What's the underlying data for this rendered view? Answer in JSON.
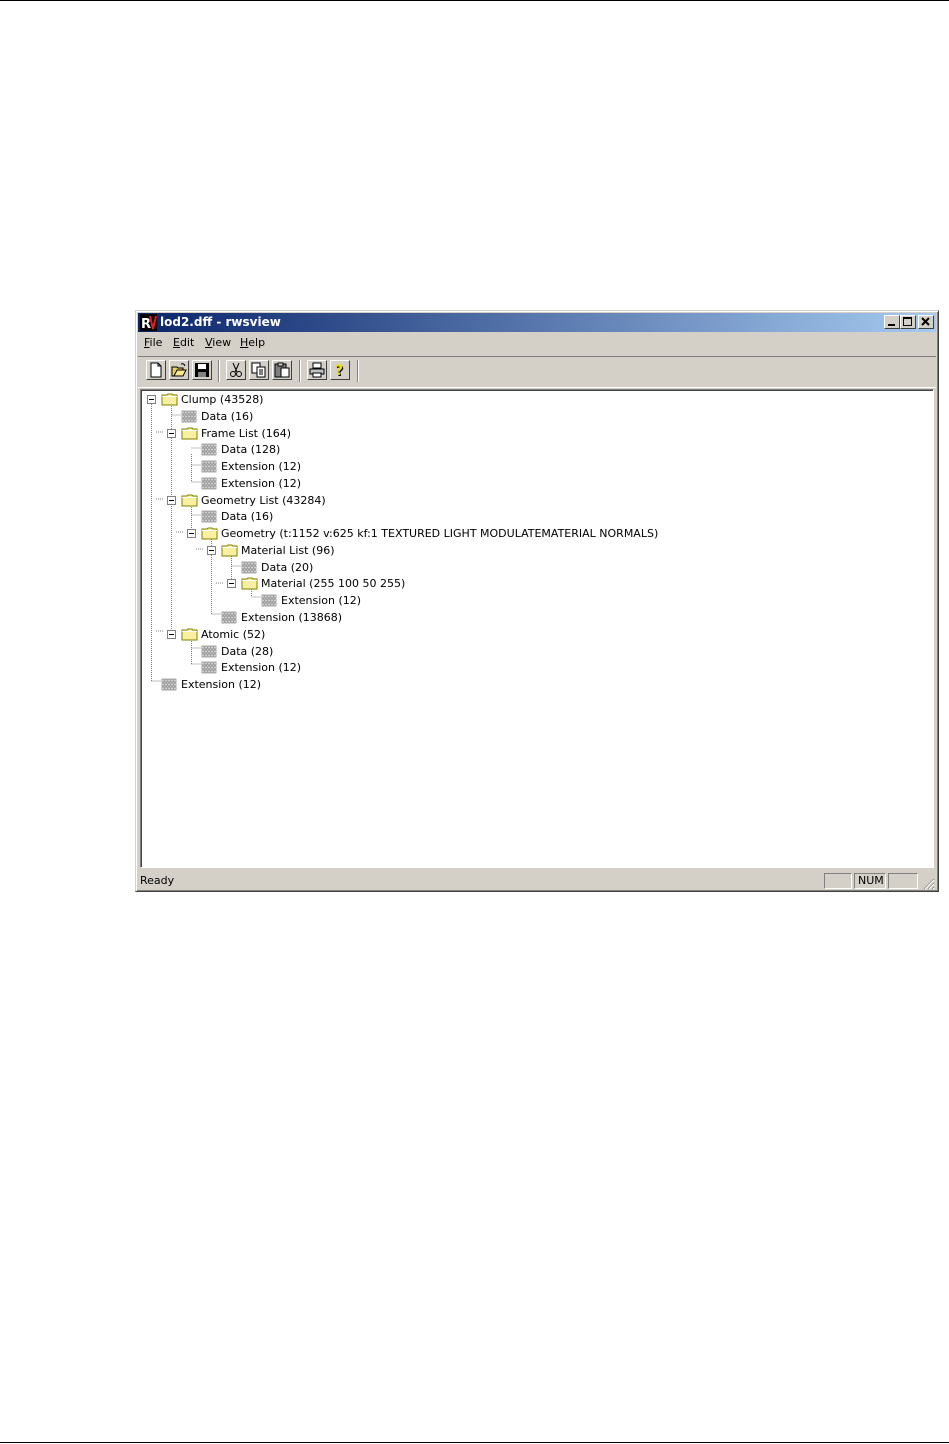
{
  "window": {
    "title": "lod2.dff - rwsview",
    "app_icon": "rw-logo",
    "controls": [
      "minimize-icon",
      "maximize-icon",
      "close-icon"
    ]
  },
  "menu": {
    "file": {
      "hot": "F",
      "rest": "ile"
    },
    "edit": {
      "hot": "E",
      "rest": "dit"
    },
    "view": {
      "hot": "V",
      "rest": "iew"
    },
    "help": {
      "hot": "H",
      "rest": "elp"
    }
  },
  "toolbar": {
    "buttons": [
      "new-icon",
      "open-icon",
      "save-icon",
      "cut-icon",
      "copy-icon",
      "paste-icon",
      "print-icon",
      "help-icon"
    ]
  },
  "tree": [
    {
      "label": "Clump (43528)",
      "type": "folder",
      "expanded": true
    },
    {
      "label": "Data (16)",
      "type": "binary"
    },
    {
      "label": "Frame List (164)",
      "type": "folder",
      "expanded": true
    },
    {
      "label": "Data (128)",
      "type": "binary"
    },
    {
      "label": "Extension (12)",
      "type": "binary"
    },
    {
      "label": "Extension (12)",
      "type": "binary"
    },
    {
      "label": "Geometry List (43284)",
      "type": "folder",
      "expanded": true
    },
    {
      "label": "Data (16)",
      "type": "binary"
    },
    {
      "label": "Geometry (t:1152 v:625 kf:1 TEXTURED LIGHT MODULATEMATERIAL NORMALS)",
      "type": "folder",
      "expanded": true
    },
    {
      "label": "Material List (96)",
      "type": "folder",
      "expanded": true
    },
    {
      "label": "Data (20)",
      "type": "binary"
    },
    {
      "label": "Material (255 100 50 255)",
      "type": "folder",
      "expanded": true
    },
    {
      "label": "Extension (12)",
      "type": "binary"
    },
    {
      "label": "Extension (13868)",
      "type": "binary"
    },
    {
      "label": "Atomic (52)",
      "type": "folder",
      "expanded": true
    },
    {
      "label": "Data (28)",
      "type": "binary"
    },
    {
      "label": "Extension (12)",
      "type": "binary"
    },
    {
      "label": "Extension (12)",
      "type": "binary"
    }
  ],
  "status": {
    "text": "Ready",
    "num": "NUM"
  }
}
